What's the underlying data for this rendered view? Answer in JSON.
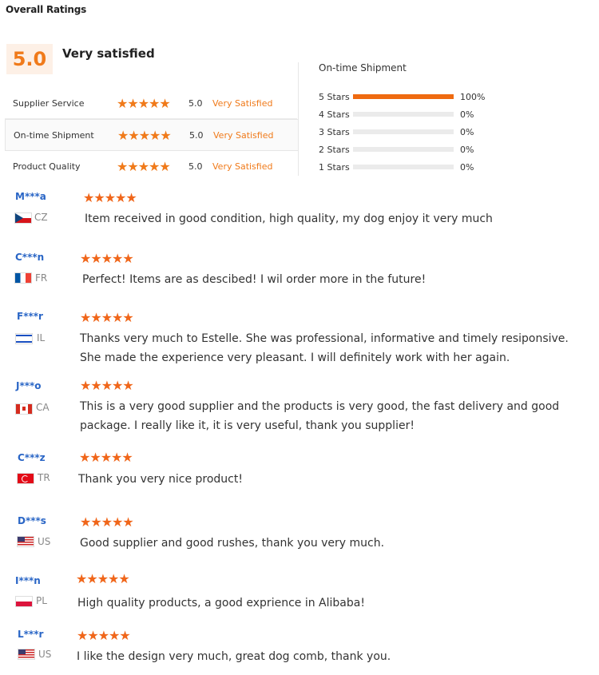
{
  "page": {
    "title": "Overall Ratings"
  },
  "overall": {
    "score": "5.0",
    "label": "Very satisfied"
  },
  "categories": [
    {
      "label": "Supplier Service",
      "score": "5.0",
      "status": "Very Satisfied",
      "stars": 5
    },
    {
      "label": "On-time Shipment",
      "score": "5.0",
      "status": "Very Satisfied",
      "stars": 5
    },
    {
      "label": "Product Quality",
      "score": "5.0",
      "status": "Very Satisfied",
      "stars": 5
    }
  ],
  "distribution": {
    "title": "On-time Shipment",
    "rows": [
      {
        "label": "5 Stars",
        "pct": "100%",
        "value": 100
      },
      {
        "label": "4 Stars",
        "pct": "0%",
        "value": 0
      },
      {
        "label": "3 Stars",
        "pct": "0%",
        "value": 0
      },
      {
        "label": "2 Stars",
        "pct": "0%",
        "value": 0
      },
      {
        "label": "1 Stars",
        "pct": "0%",
        "value": 0
      }
    ]
  },
  "reviews": [
    {
      "name": "M***a",
      "country": "CZ",
      "flag": "cz",
      "stars": 5,
      "text": "Item received in good condition, high quality, my dog enjoy it very much"
    },
    {
      "name": "C***n",
      "country": "FR",
      "flag": "fr",
      "stars": 5,
      "text": "Perfect! Items are as descibed! I wil order more in the future!"
    },
    {
      "name": "F***r",
      "country": "IL",
      "flag": "il",
      "stars": 5,
      "text": "Thanks very much to Estelle. She was professional, informative and  timely resiponsive. She made the experience very pleasant. I will definitely work with her again."
    },
    {
      "name": "J***o",
      "country": "CA",
      "flag": "ca",
      "stars": 5,
      "text": "This is a very good supplier and the products is very good, the fast delivery and good package. I really like it, it is very useful, thank you supplier!"
    },
    {
      "name": "C***z",
      "country": "TR",
      "flag": "tr",
      "stars": 5,
      "text": "Thank you very nice product!"
    },
    {
      "name": "D***s",
      "country": "US",
      "flag": "us",
      "stars": 5,
      "text": "Good supplier and good rushes, thank you very much."
    },
    {
      "name": "I***n",
      "country": "PL",
      "flag": "pl",
      "stars": 5,
      "text": "High quality products, a good exprience in Alibaba!"
    },
    {
      "name": "L***r",
      "country": "US",
      "flag": "us",
      "stars": 5,
      "text": "I like the design very much, great dog comb, thank you."
    }
  ],
  "colors": {
    "accent": "#f07a1a",
    "name_link": "#2a66c6"
  }
}
